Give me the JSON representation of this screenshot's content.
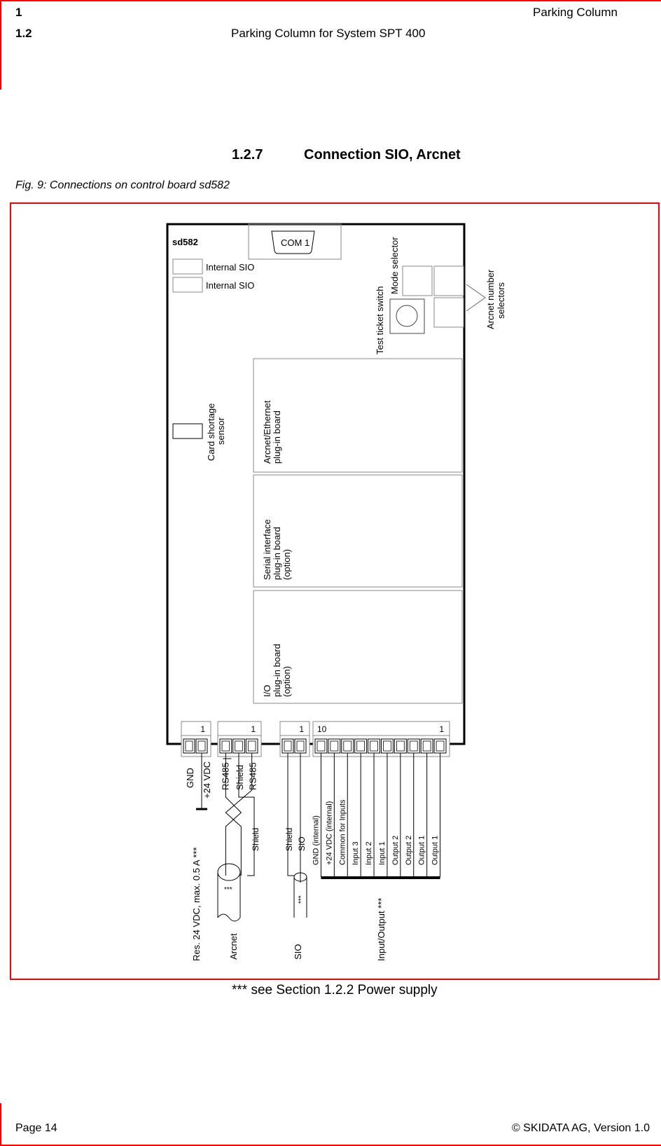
{
  "header": {
    "chapter_number": "1",
    "chapter_title": "Parking Column",
    "section_number": "1.2",
    "section_title": "Parking Column for System SPT 400"
  },
  "heading": {
    "number": "1.2.7",
    "title": "Connection SIO, Arcnet"
  },
  "figure": {
    "caption": "Fig. 9: Connections on control board sd582",
    "board_label": "sd582",
    "com_port": "COM 1",
    "internal_sio": [
      "Internal SIO",
      "Internal SIO"
    ],
    "card_shortage_sensor": [
      "Card shortage",
      "sensor"
    ],
    "test_ticket_switch": "Test ticket switch",
    "mode_selector": "Mode selector",
    "arcnet_number_selectors": [
      "Arcnet number",
      "selectors"
    ],
    "plugin_boards": [
      {
        "lines": [
          "Arcnet/Ethernet",
          "plug-in board"
        ]
      },
      {
        "lines": [
          "Serial interface",
          "plug-in board",
          "(option)"
        ]
      },
      {
        "lines": [
          "I/O",
          "plug-in board",
          "(option)"
        ]
      }
    ],
    "connectors": [
      {
        "pin_label_left": "",
        "pin_label_right": "1",
        "pins": 2
      },
      {
        "pin_label_left": "",
        "pin_label_right": "1",
        "pins": 3
      },
      {
        "pin_label_left": "",
        "pin_label_right": "1",
        "pins": 2
      },
      {
        "pin_label_left": "10",
        "pin_label_right": "1",
        "pins": 10
      }
    ],
    "power_wires": [
      "GND",
      "+24 VDC"
    ],
    "arcnet_wires": [
      "RS485",
      "Shield",
      "RS485"
    ],
    "arcnet_cable_shield": "Shield",
    "sio_wires": [
      "Shield",
      "SIO"
    ],
    "io_wires": [
      "GND (internal)",
      "+24 VDC (internal)",
      "Common for Inputs",
      "Input 3",
      "Input 2",
      "Input 1",
      "Output 2",
      "Output 2",
      "Output 1",
      "Output 1"
    ],
    "cable_marker": "***",
    "group_labels": {
      "power": "Res. 24 VDC, max. 0.5  A   ***",
      "arcnet": "Arcnet",
      "sio": "SIO",
      "io": "Input/Output   ***"
    }
  },
  "footnote": "*** see Section 1.2.2 Power supply",
  "footer": {
    "page": "Page 14",
    "copyright": "© SKIDATA AG, Version 1.0"
  },
  "colors": {
    "frame": "#ff0000",
    "line": "#000000",
    "box_border": "#808080"
  }
}
